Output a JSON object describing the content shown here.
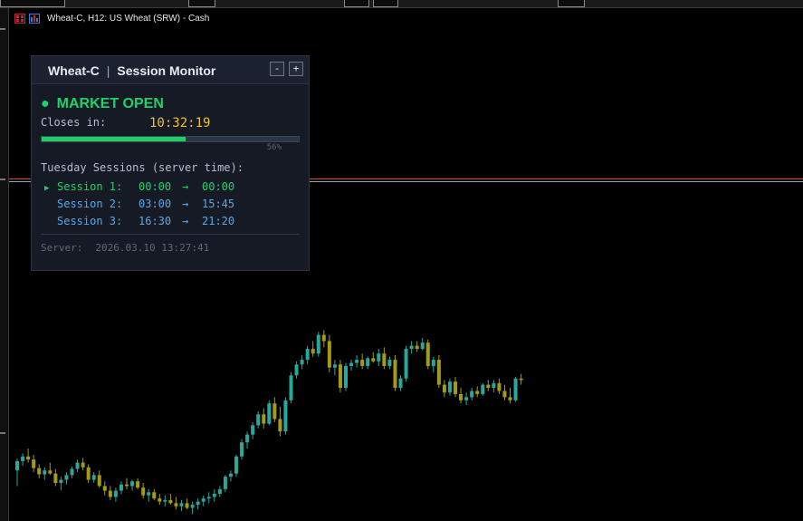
{
  "window": {
    "chart_title": "Wheat-C, H12:  US Wheat (SRW) - Cash",
    "icons": [
      "chart-grid-icon",
      "indicator-icon"
    ]
  },
  "panel": {
    "symbol": "Wheat-C",
    "separator": "|",
    "title": "Session Monitor",
    "minimize_label": "-",
    "maximize_label": "+",
    "status_dot": "●",
    "status_text": "MARKET OPEN",
    "status_color": "#1fd16a",
    "closes_label": "Closes in:",
    "closes_value": "10:32:19",
    "progress_percent": 56,
    "progress_label": "56%",
    "sessions_heading": "Tuesday Sessions (server time):",
    "active_marker": "▶",
    "sessions": [
      {
        "name": "Session 1:",
        "start": "00:00",
        "arrow": "→",
        "end": "00:00",
        "active": true
      },
      {
        "name": "Session 2:",
        "start": "03:00",
        "arrow": "→",
        "end": "15:45",
        "active": false
      },
      {
        "name": "Session 3:",
        "start": "16:30",
        "arrow": "→",
        "end": "21:20",
        "active": false
      }
    ],
    "server_label": "Server:",
    "server_time": "2026.03.10 13:27:41"
  },
  "colors": {
    "bull": "#2aa69b",
    "bear": "#a39b16",
    "ask_line": "#d9413c",
    "bid_line": "#9aa0a6",
    "active_session": "#1fd16a",
    "inactive_session": "#5aa8e8"
  },
  "chart_data": {
    "type": "candlestick",
    "series": [
      {
        "o": 30,
        "h": 45,
        "l": 10,
        "c": 42
      },
      {
        "o": 42,
        "h": 52,
        "l": 36,
        "c": 48
      },
      {
        "o": 48,
        "h": 58,
        "l": 40,
        "c": 44
      },
      {
        "o": 44,
        "h": 50,
        "l": 28,
        "c": 33
      },
      {
        "o": 33,
        "h": 38,
        "l": 20,
        "c": 25
      },
      {
        "o": 25,
        "h": 34,
        "l": 18,
        "c": 30
      },
      {
        "o": 30,
        "h": 40,
        "l": 24,
        "c": 26
      },
      {
        "o": 26,
        "h": 32,
        "l": 10,
        "c": 14
      },
      {
        "o": 14,
        "h": 22,
        "l": 5,
        "c": 18
      },
      {
        "o": 18,
        "h": 28,
        "l": 12,
        "c": 24
      },
      {
        "o": 24,
        "h": 35,
        "l": 20,
        "c": 32
      },
      {
        "o": 32,
        "h": 44,
        "l": 28,
        "c": 40
      },
      {
        "o": 40,
        "h": 46,
        "l": 30,
        "c": 34
      },
      {
        "o": 34,
        "h": 38,
        "l": 14,
        "c": 18
      },
      {
        "o": 18,
        "h": 28,
        "l": 14,
        "c": 24
      },
      {
        "o": 24,
        "h": 30,
        "l": 8,
        "c": 10
      },
      {
        "o": 10,
        "h": 16,
        "l": -2,
        "c": 4
      },
      {
        "o": 4,
        "h": 10,
        "l": -8,
        "c": -4
      },
      {
        "o": -4,
        "h": 8,
        "l": -10,
        "c": 4
      },
      {
        "o": 4,
        "h": 16,
        "l": 0,
        "c": 12
      },
      {
        "o": 12,
        "h": 20,
        "l": 6,
        "c": 10
      },
      {
        "o": 10,
        "h": 18,
        "l": 4,
        "c": 16
      },
      {
        "o": 16,
        "h": 20,
        "l": 6,
        "c": 8
      },
      {
        "o": 8,
        "h": 14,
        "l": -6,
        "c": -2
      },
      {
        "o": -2,
        "h": 6,
        "l": -10,
        "c": 2
      },
      {
        "o": 2,
        "h": 6,
        "l": -8,
        "c": -6
      },
      {
        "o": -6,
        "h": 0,
        "l": -14,
        "c": -10
      },
      {
        "o": -10,
        "h": -2,
        "l": -16,
        "c": -8
      },
      {
        "o": -8,
        "h": 0,
        "l": -14,
        "c": -12
      },
      {
        "o": -12,
        "h": -4,
        "l": -20,
        "c": -16
      },
      {
        "o": -16,
        "h": -8,
        "l": -22,
        "c": -12
      },
      {
        "o": -12,
        "h": -6,
        "l": -20,
        "c": -18
      },
      {
        "o": -18,
        "h": -10,
        "l": -26,
        "c": -14
      },
      {
        "o": -14,
        "h": -6,
        "l": -20,
        "c": -10
      },
      {
        "o": -10,
        "h": -2,
        "l": -16,
        "c": -6
      },
      {
        "o": -6,
        "h": 2,
        "l": -12,
        "c": -4
      },
      {
        "o": -4,
        "h": 6,
        "l": -10,
        "c": 0
      },
      {
        "o": 0,
        "h": 10,
        "l": -4,
        "c": 6
      },
      {
        "o": 6,
        "h": 24,
        "l": 2,
        "c": 22
      },
      {
        "o": 22,
        "h": 30,
        "l": 16,
        "c": 26
      },
      {
        "o": 26,
        "h": 50,
        "l": 22,
        "c": 48
      },
      {
        "o": 48,
        "h": 70,
        "l": 44,
        "c": 66
      },
      {
        "o": 66,
        "h": 80,
        "l": 58,
        "c": 76
      },
      {
        "o": 76,
        "h": 92,
        "l": 70,
        "c": 88
      },
      {
        "o": 88,
        "h": 106,
        "l": 84,
        "c": 102
      },
      {
        "o": 102,
        "h": 110,
        "l": 84,
        "c": 90
      },
      {
        "o": 90,
        "h": 120,
        "l": 88,
        "c": 116
      },
      {
        "o": 116,
        "h": 124,
        "l": 92,
        "c": 96
      },
      {
        "o": 96,
        "h": 112,
        "l": 74,
        "c": 80
      },
      {
        "o": 80,
        "h": 124,
        "l": 76,
        "c": 120
      },
      {
        "o": 120,
        "h": 156,
        "l": 116,
        "c": 152
      },
      {
        "o": 152,
        "h": 170,
        "l": 148,
        "c": 166
      },
      {
        "o": 166,
        "h": 178,
        "l": 160,
        "c": 172
      },
      {
        "o": 172,
        "h": 190,
        "l": 166,
        "c": 186
      },
      {
        "o": 186,
        "h": 196,
        "l": 176,
        "c": 180
      },
      {
        "o": 180,
        "h": 208,
        "l": 176,
        "c": 204
      },
      {
        "o": 204,
        "h": 210,
        "l": 188,
        "c": 196
      },
      {
        "o": 196,
        "h": 204,
        "l": 156,
        "c": 162
      },
      {
        "o": 162,
        "h": 172,
        "l": 152,
        "c": 166
      },
      {
        "o": 166,
        "h": 172,
        "l": 130,
        "c": 136
      },
      {
        "o": 136,
        "h": 168,
        "l": 132,
        "c": 164
      },
      {
        "o": 164,
        "h": 172,
        "l": 158,
        "c": 168
      },
      {
        "o": 168,
        "h": 178,
        "l": 162,
        "c": 172
      },
      {
        "o": 172,
        "h": 180,
        "l": 160,
        "c": 164
      },
      {
        "o": 164,
        "h": 176,
        "l": 160,
        "c": 174
      },
      {
        "o": 174,
        "h": 182,
        "l": 168,
        "c": 170
      },
      {
        "o": 170,
        "h": 186,
        "l": 164,
        "c": 180
      },
      {
        "o": 180,
        "h": 188,
        "l": 160,
        "c": 164
      },
      {
        "o": 164,
        "h": 176,
        "l": 160,
        "c": 172
      },
      {
        "o": 172,
        "h": 178,
        "l": 132,
        "c": 136
      },
      {
        "o": 136,
        "h": 152,
        "l": 132,
        "c": 148
      },
      {
        "o": 148,
        "h": 190,
        "l": 144,
        "c": 186
      },
      {
        "o": 186,
        "h": 196,
        "l": 180,
        "c": 190
      },
      {
        "o": 190,
        "h": 196,
        "l": 182,
        "c": 186
      },
      {
        "o": 186,
        "h": 200,
        "l": 184,
        "c": 194
      },
      {
        "o": 194,
        "h": 198,
        "l": 160,
        "c": 164
      },
      {
        "o": 164,
        "h": 176,
        "l": 156,
        "c": 172
      },
      {
        "o": 172,
        "h": 178,
        "l": 136,
        "c": 140
      },
      {
        "o": 140,
        "h": 146,
        "l": 124,
        "c": 130
      },
      {
        "o": 130,
        "h": 148,
        "l": 126,
        "c": 144
      },
      {
        "o": 144,
        "h": 150,
        "l": 124,
        "c": 128
      },
      {
        "o": 128,
        "h": 136,
        "l": 116,
        "c": 120
      },
      {
        "o": 120,
        "h": 130,
        "l": 114,
        "c": 124
      },
      {
        "o": 124,
        "h": 136,
        "l": 120,
        "c": 132
      },
      {
        "o": 132,
        "h": 138,
        "l": 124,
        "c": 128
      },
      {
        "o": 128,
        "h": 142,
        "l": 126,
        "c": 140
      },
      {
        "o": 140,
        "h": 146,
        "l": 132,
        "c": 136
      },
      {
        "o": 136,
        "h": 146,
        "l": 130,
        "c": 142
      },
      {
        "o": 142,
        "h": 148,
        "l": 128,
        "c": 132
      },
      {
        "o": 132,
        "h": 140,
        "l": 120,
        "c": 124
      },
      {
        "o": 124,
        "h": 136,
        "l": 116,
        "c": 120
      },
      {
        "o": 120,
        "h": 150,
        "l": 118,
        "c": 148
      },
      {
        "o": 148,
        "h": 154,
        "l": 140,
        "c": 146
      }
    ]
  }
}
